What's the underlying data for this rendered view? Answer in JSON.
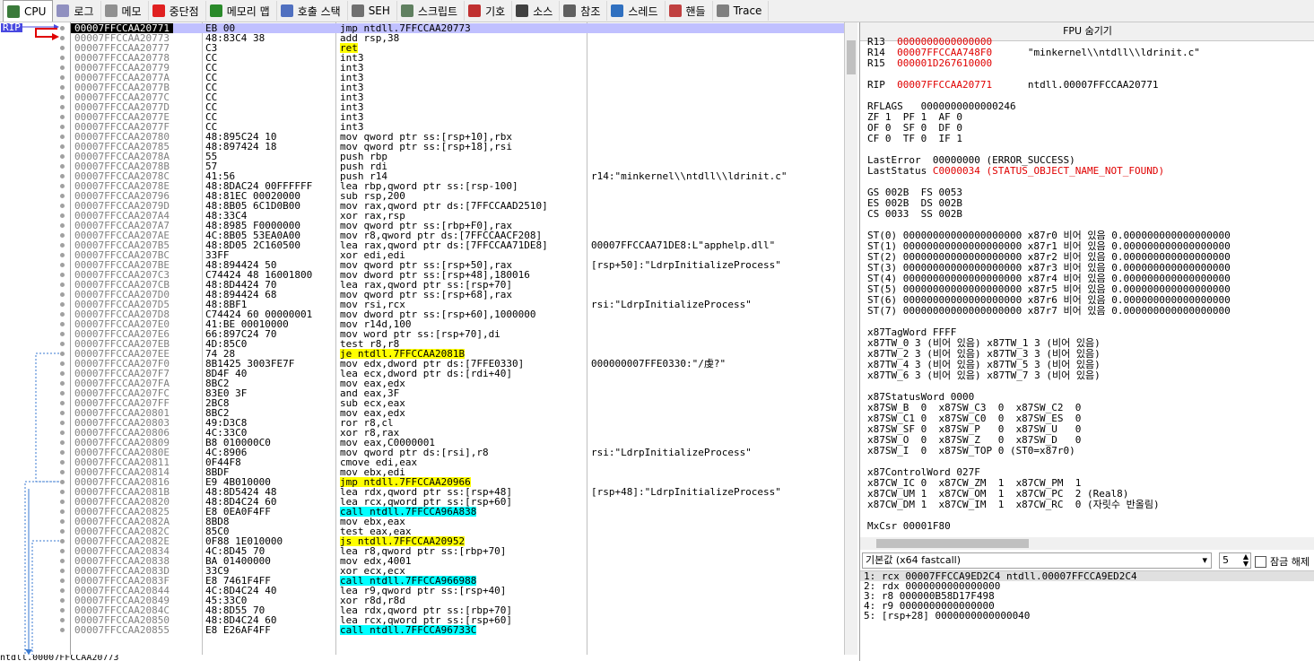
{
  "tabs": [
    {
      "label": "CPU",
      "icon": "cpu-icon",
      "color": "#3a7a3a"
    },
    {
      "label": "로그",
      "icon": "log-icon",
      "color": "#9090c0"
    },
    {
      "label": "메모",
      "icon": "notes-icon",
      "color": "#909090"
    },
    {
      "label": "중단점",
      "icon": "breakpoint-icon",
      "color": "#e02020"
    },
    {
      "label": "메모리 맵",
      "icon": "memory-map-icon",
      "color": "#2a8a2a"
    },
    {
      "label": "호출 스택",
      "icon": "call-stack-icon",
      "color": "#5070c0"
    },
    {
      "label": "SEH",
      "icon": "seh-icon",
      "color": "#707070"
    },
    {
      "label": "스크립트",
      "icon": "script-icon",
      "color": "#608060"
    },
    {
      "label": "기호",
      "icon": "symbols-icon",
      "color": "#c03030"
    },
    {
      "label": "소스",
      "icon": "source-icon",
      "color": "#404040"
    },
    {
      "label": "참조",
      "icon": "references-icon",
      "color": "#606060"
    },
    {
      "label": "스레드",
      "icon": "threads-icon",
      "color": "#3070c0"
    },
    {
      "label": "핸들",
      "icon": "handles-icon",
      "color": "#c04040"
    },
    {
      "label": "Trace",
      "icon": "trace-icon",
      "color": "#808080"
    }
  ],
  "gutter": {
    "rip_label": "RIP"
  },
  "disasm": [
    {
      "addr": "00007FFCCAA20771",
      "bytes": "EB 00",
      "ins": "jmp ntdll.7FFCCAA20773",
      "cmt": "",
      "current": true
    },
    {
      "addr": "00007FFCCAA20773",
      "bytes": "48:83C4 38",
      "ins": "add rsp,38",
      "cmt": ""
    },
    {
      "addr": "00007FFCCAA20777",
      "bytes": "C3",
      "ins": "ret",
      "cmt": "",
      "hl": "y"
    },
    {
      "addr": "00007FFCCAA20778",
      "bytes": "CC",
      "ins": "int3",
      "cmt": ""
    },
    {
      "addr": "00007FFCCAA20779",
      "bytes": "CC",
      "ins": "int3",
      "cmt": ""
    },
    {
      "addr": "00007FFCCAA2077A",
      "bytes": "CC",
      "ins": "int3",
      "cmt": ""
    },
    {
      "addr": "00007FFCCAA2077B",
      "bytes": "CC",
      "ins": "int3",
      "cmt": ""
    },
    {
      "addr": "00007FFCCAA2077C",
      "bytes": "CC",
      "ins": "int3",
      "cmt": ""
    },
    {
      "addr": "00007FFCCAA2077D",
      "bytes": "CC",
      "ins": "int3",
      "cmt": ""
    },
    {
      "addr": "00007FFCCAA2077E",
      "bytes": "CC",
      "ins": "int3",
      "cmt": ""
    },
    {
      "addr": "00007FFCCAA2077F",
      "bytes": "CC",
      "ins": "int3",
      "cmt": ""
    },
    {
      "addr": "00007FFCCAA20780",
      "bytes": "48:895C24 10",
      "ins": "mov qword ptr ss:[rsp+10],rbx",
      "cmt": ""
    },
    {
      "addr": "00007FFCCAA20785",
      "bytes": "48:897424 18",
      "ins": "mov qword ptr ss:[rsp+18],rsi",
      "cmt": ""
    },
    {
      "addr": "00007FFCCAA2078A",
      "bytes": "55",
      "ins": "push rbp",
      "cmt": ""
    },
    {
      "addr": "00007FFCCAA2078B",
      "bytes": "57",
      "ins": "push rdi",
      "cmt": ""
    },
    {
      "addr": "00007FFCCAA2078C",
      "bytes": "41:56",
      "ins": "push r14",
      "cmt": "r14:\"minkernel\\\\ntdll\\\\ldrinit.c\""
    },
    {
      "addr": "00007FFCCAA2078E",
      "bytes": "48:8DAC24 00FFFFFF",
      "ins": "lea rbp,qword ptr ss:[rsp-100]",
      "cmt": ""
    },
    {
      "addr": "00007FFCCAA20796",
      "bytes": "48:81EC 00020000",
      "ins": "sub rsp,200",
      "cmt": ""
    },
    {
      "addr": "00007FFCCAA2079D",
      "bytes": "48:8B05 6C1D0B00",
      "ins": "mov rax,qword ptr ds:[7FFCCAAD2510]",
      "cmt": ""
    },
    {
      "addr": "00007FFCCAA207A4",
      "bytes": "48:33C4",
      "ins": "xor rax,rsp",
      "cmt": ""
    },
    {
      "addr": "00007FFCCAA207A7",
      "bytes": "48:8985 F0000000",
      "ins": "mov qword ptr ss:[rbp+F0],rax",
      "cmt": ""
    },
    {
      "addr": "00007FFCCAA207AE",
      "bytes": "4C:8B05 53EA0A00",
      "ins": "mov r8,qword ptr ds:[7FFCCAACF208]",
      "cmt": ""
    },
    {
      "addr": "00007FFCCAA207B5",
      "bytes": "48:8D05 2C160500",
      "ins": "lea rax,qword ptr ds:[7FFCCAA71DE8]",
      "cmt": "00007FFCCAA71DE8:L\"apphelp.dll\""
    },
    {
      "addr": "00007FFCCAA207BC",
      "bytes": "33FF",
      "ins": "xor edi,edi",
      "cmt": ""
    },
    {
      "addr": "00007FFCCAA207BE",
      "bytes": "48:894424 50",
      "ins": "mov qword ptr ss:[rsp+50],rax",
      "cmt": "[rsp+50]:\"LdrpInitializeProcess\""
    },
    {
      "addr": "00007FFCCAA207C3",
      "bytes": "C74424 48 16001800",
      "ins": "mov dword ptr ss:[rsp+48],180016",
      "cmt": ""
    },
    {
      "addr": "00007FFCCAA207CB",
      "bytes": "48:8D4424 70",
      "ins": "lea rax,qword ptr ss:[rsp+70]",
      "cmt": ""
    },
    {
      "addr": "00007FFCCAA207D0",
      "bytes": "48:894424 68",
      "ins": "mov qword ptr ss:[rsp+68],rax",
      "cmt": ""
    },
    {
      "addr": "00007FFCCAA207D5",
      "bytes": "48:8BF1",
      "ins": "mov rsi,rcx",
      "cmt": "rsi:\"LdrpInitializeProcess\""
    },
    {
      "addr": "00007FFCCAA207D8",
      "bytes": "C74424 60 00000001",
      "ins": "mov dword ptr ss:[rsp+60],1000000",
      "cmt": ""
    },
    {
      "addr": "00007FFCCAA207E0",
      "bytes": "41:BE 00010000",
      "ins": "mov r14d,100",
      "cmt": ""
    },
    {
      "addr": "00007FFCCAA207E6",
      "bytes": "66:897C24 70",
      "ins": "mov word ptr ss:[rsp+70],di",
      "cmt": ""
    },
    {
      "addr": "00007FFCCAA207EB",
      "bytes": "4D:85C0",
      "ins": "test r8,r8",
      "cmt": ""
    },
    {
      "addr": "00007FFCCAA207EE",
      "bytes": "74 28",
      "ins": "je ntdll.7FFCCAA2081B",
      "cmt": "",
      "hl": "y"
    },
    {
      "addr": "00007FFCCAA207F0",
      "bytes": "8B1425 3003FE7F",
      "ins": "mov edx,dword ptr ds:[7FFE0330]",
      "cmt": "000000007FFE0330:\"/虔?\""
    },
    {
      "addr": "00007FFCCAA207F7",
      "bytes": "8D4F 40",
      "ins": "lea ecx,dword ptr ds:[rdi+40]",
      "cmt": ""
    },
    {
      "addr": "00007FFCCAA207FA",
      "bytes": "8BC2",
      "ins": "mov eax,edx",
      "cmt": ""
    },
    {
      "addr": "00007FFCCAA207FC",
      "bytes": "83E0 3F",
      "ins": "and eax,3F",
      "cmt": ""
    },
    {
      "addr": "00007FFCCAA207FF",
      "bytes": "2BC8",
      "ins": "sub ecx,eax",
      "cmt": ""
    },
    {
      "addr": "00007FFCCAA20801",
      "bytes": "8BC2",
      "ins": "mov eax,edx",
      "cmt": ""
    },
    {
      "addr": "00007FFCCAA20803",
      "bytes": "49:D3C8",
      "ins": "ror r8,cl",
      "cmt": ""
    },
    {
      "addr": "00007FFCCAA20806",
      "bytes": "4C:33C0",
      "ins": "xor r8,rax",
      "cmt": ""
    },
    {
      "addr": "00007FFCCAA20809",
      "bytes": "B8 010000C0",
      "ins": "mov eax,C0000001",
      "cmt": ""
    },
    {
      "addr": "00007FFCCAA2080E",
      "bytes": "4C:8906",
      "ins": "mov qword ptr ds:[rsi],r8",
      "cmt": "rsi:\"LdrpInitializeProcess\""
    },
    {
      "addr": "00007FFCCAA20811",
      "bytes": "0F44F8",
      "ins": "cmove edi,eax",
      "cmt": ""
    },
    {
      "addr": "00007FFCCAA20814",
      "bytes": "8BDF",
      "ins": "mov ebx,edi",
      "cmt": ""
    },
    {
      "addr": "00007FFCCAA20816",
      "bytes": "E9 4B010000",
      "ins": "jmp ntdll.7FFCCAA20966",
      "cmt": "",
      "hl": "y"
    },
    {
      "addr": "00007FFCCAA2081B",
      "bytes": "48:8D5424 48",
      "ins": "lea rdx,qword ptr ss:[rsp+48]",
      "cmt": "[rsp+48]:\"LdrpInitializeProcess\""
    },
    {
      "addr": "00007FFCCAA20820",
      "bytes": "48:8D4C24 60",
      "ins": "lea rcx,qword ptr ss:[rsp+60]",
      "cmt": ""
    },
    {
      "addr": "00007FFCCAA20825",
      "bytes": "E8 0EA0F4FF",
      "ins": "call ntdll.7FFCCA96A838",
      "cmt": "",
      "hl": "c"
    },
    {
      "addr": "00007FFCCAA2082A",
      "bytes": "8BD8",
      "ins": "mov ebx,eax",
      "cmt": ""
    },
    {
      "addr": "00007FFCCAA2082C",
      "bytes": "85C0",
      "ins": "test eax,eax",
      "cmt": ""
    },
    {
      "addr": "00007FFCCAA2082E",
      "bytes": "0F88 1E010000",
      "ins": "js ntdll.7FFCCAA20952",
      "cmt": "",
      "hl": "y"
    },
    {
      "addr": "00007FFCCAA20834",
      "bytes": "4C:8D45 70",
      "ins": "lea r8,qword ptr ss:[rbp+70]",
      "cmt": ""
    },
    {
      "addr": "00007FFCCAA20838",
      "bytes": "BA 01400000",
      "ins": "mov edx,4001",
      "cmt": ""
    },
    {
      "addr": "00007FFCCAA2083D",
      "bytes": "33C9",
      "ins": "xor ecx,ecx",
      "cmt": ""
    },
    {
      "addr": "00007FFCCAA2083F",
      "bytes": "E8 7461F4FF",
      "ins": "call ntdll.7FFCCA966988",
      "cmt": "",
      "hl": "c"
    },
    {
      "addr": "00007FFCCAA20844",
      "bytes": "4C:8D4C24 40",
      "ins": "lea r9,qword ptr ss:[rsp+40]",
      "cmt": ""
    },
    {
      "addr": "00007FFCCAA20849",
      "bytes": "45:33C0",
      "ins": "xor r8d,r8d",
      "cmt": ""
    },
    {
      "addr": "00007FFCCAA2084C",
      "bytes": "48:8D55 70",
      "ins": "lea rdx,qword ptr ss:[rbp+70]",
      "cmt": ""
    },
    {
      "addr": "00007FFCCAA20850",
      "bytes": "48:8D4C24 60",
      "ins": "lea rcx,qword ptr ss:[rsp+60]",
      "cmt": ""
    },
    {
      "addr": "00007FFCCAA20855",
      "bytes": "E8 E26AF4FF",
      "ins": "call ntdll.7FFCCA96733C",
      "cmt": "",
      "hl": "c"
    }
  ],
  "statusbar": {
    "text": "ntdll.00007FFCCAA20773"
  },
  "fpu": {
    "header": "FPU 숨기기",
    "lines": [
      {
        "t": "R13  0000000000000000",
        "red": false
      },
      {
        "t": "R14  00007FFCCAA748F0      \"minkernel\\\\ntdll\\\\ldrinit.c\"",
        "red": false
      },
      {
        "t": "R15  000001D267610000",
        "red": false
      },
      {
        "t": "",
        "red": false
      },
      {
        "t": "RIP  00007FFCCAA20771      ntdll.00007FFCCAA20771",
        "red": false
      },
      {
        "t": "",
        "red": false
      },
      {
        "t": "RFLAGS   0000000000000246",
        "red": false
      },
      {
        "t": "ZF 1  PF 1  AF 0",
        "red": false
      },
      {
        "t": "OF 0  SF 0  DF 0",
        "red": false
      },
      {
        "t": "CF 0  TF 0  IF 1",
        "red": false
      },
      {
        "t": "",
        "red": false
      },
      {
        "t": "LastError  00000000 (ERROR_SUCCESS)",
        "red": false
      },
      {
        "t": "LastStatus C0000034 (STATUS_OBJECT_NAME_NOT_FOUND)",
        "red": false
      },
      {
        "t": "",
        "red": false
      },
      {
        "t": "GS 002B  FS 0053",
        "red": false
      },
      {
        "t": "ES 002B  DS 002B",
        "red": false
      },
      {
        "t": "CS 0033  SS 002B",
        "red": false
      },
      {
        "t": "",
        "red": false
      },
      {
        "t": "ST(0) 00000000000000000000 x87r0 비어 있음 0.000000000000000000",
        "red": false
      },
      {
        "t": "ST(1) 00000000000000000000 x87r1 비어 있음 0.000000000000000000",
        "red": false
      },
      {
        "t": "ST(2) 00000000000000000000 x87r2 비어 있음 0.000000000000000000",
        "red": false
      },
      {
        "t": "ST(3) 00000000000000000000 x87r3 비어 있음 0.000000000000000000",
        "red": false
      },
      {
        "t": "ST(4) 00000000000000000000 x87r4 비어 있음 0.000000000000000000",
        "red": false
      },
      {
        "t": "ST(5) 00000000000000000000 x87r5 비어 있음 0.000000000000000000",
        "red": false
      },
      {
        "t": "ST(6) 00000000000000000000 x87r6 비어 있음 0.000000000000000000",
        "red": false
      },
      {
        "t": "ST(7) 00000000000000000000 x87r7 비어 있음 0.000000000000000000",
        "red": false
      },
      {
        "t": "",
        "red": false
      },
      {
        "t": "x87TagWord FFFF",
        "red": false
      },
      {
        "t": "x87TW_0 3 (비어 있음) x87TW_1 3 (비어 있음)",
        "red": false
      },
      {
        "t": "x87TW_2 3 (비어 있음) x87TW_3 3 (비어 있음)",
        "red": false
      },
      {
        "t": "x87TW_4 3 (비어 있음) x87TW_5 3 (비어 있음)",
        "red": false
      },
      {
        "t": "x87TW_6 3 (비어 있음) x87TW_7 3 (비어 있음)",
        "red": false
      },
      {
        "t": "",
        "red": false
      },
      {
        "t": "x87StatusWord 0000",
        "red": false
      },
      {
        "t": "x87SW_B  0  x87SW_C3  0  x87SW_C2  0",
        "red": false
      },
      {
        "t": "x87SW_C1 0  x87SW_C0  0  x87SW_ES  0",
        "red": false
      },
      {
        "t": "x87SW_SF 0  x87SW_P   0  x87SW_U   0",
        "red": false
      },
      {
        "t": "x87SW_O  0  x87SW_Z   0  x87SW_D   0",
        "red": false
      },
      {
        "t": "x87SW_I  0  x87SW_TOP 0 (ST0=x87r0)",
        "red": false
      },
      {
        "t": "",
        "red": false
      },
      {
        "t": "x87ControlWord 027F",
        "red": false
      },
      {
        "t": "x87CW_IC 0  x87CW_ZM  1  x87CW_PM  1",
        "red": false
      },
      {
        "t": "x87CW_UM 1  x87CW_OM  1  x87CW_PC  2 (Real8)",
        "red": false
      },
      {
        "t": "x87CW_DM 1  x87CW_IM  1  x87CW_RC  0 (자릿수 반올림)",
        "red": false
      },
      {
        "t": "",
        "red": false
      },
      {
        "t": "MxCsr 00001F80",
        "red": false
      }
    ],
    "red_values": {
      "r13": "0000000000000000",
      "r14": "00007FFCCAA748F0",
      "r15": "000001D267610000",
      "rip": "00007FFCCAA20771",
      "laststatus": "C0000034 (STATUS_OBJECT_NAME_NOT_FOUND)"
    }
  },
  "callconv": {
    "label": "기본값 (x64 fastcall)",
    "arg_count": "5",
    "lock_label": "잠금 해제"
  },
  "args": [
    "1: rcx 00007FFCCA9ED2C4 ntdll.00007FFCCA9ED2C4",
    "2: rdx 0000000000000000",
    "3: r8 000000B58D17F498",
    "4: r9 0000000000000000",
    "5: [rsp+28] 0000000000000040"
  ]
}
